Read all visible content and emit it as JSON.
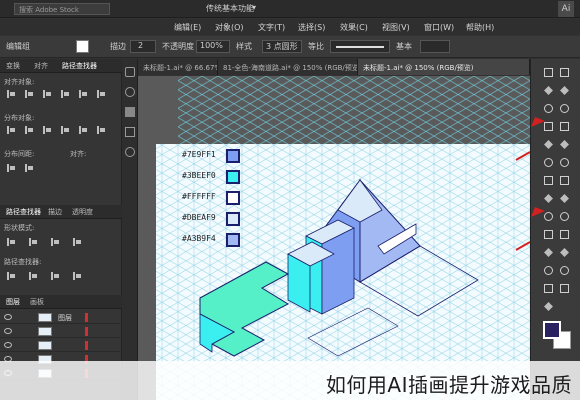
{
  "menubar": {
    "search_placeholder": "搜索 Adobe Stock",
    "workspace": "传统基本功能",
    "app_icon": "Ai"
  },
  "menu": [
    "编辑(E)",
    "对象(O)",
    "文字(T)",
    "选择(S)",
    "效果(C)",
    "视图(V)",
    "窗口(W)",
    "帮助(H)"
  ],
  "control": {
    "object_label": "编辑组",
    "stroke_label": "描边",
    "stroke_value": "2",
    "opacity_label": "不透明度",
    "opacity_value": "100%",
    "style_label": "样式",
    "uniform_label": "等比",
    "brush_label": "3 点圆形",
    "ratio_label": "基本"
  },
  "left_panel": {
    "top_tabs": [
      "变换",
      "对齐",
      "路径查找器"
    ],
    "align_objects": "对齐对象:",
    "distribute_objects": "分布对象:",
    "distribute_spacing": "分布间距:",
    "align_to": "对齐:",
    "pathfinder_tabs": [
      "路径查找器",
      "描边",
      "透明度"
    ],
    "shape_modes": "形状模式:",
    "pathfinders": "路径查找器:",
    "layers_tabs": [
      "图层",
      "画板"
    ],
    "layer_name": "图层",
    "layer_rows": 5
  },
  "doc_tabs": [
    "未标题-1.ai* @ 66.67% (RGB/预览)",
    "81-全色-海南道路.ai* @ 150% (RGB/预览)",
    "未标题-1.ai* @ 150% (RGB/预览)"
  ],
  "legend": [
    {
      "label": "#7E9FF1",
      "color": "#7E9FF1"
    },
    {
      "label": "#3BEEF0",
      "color": "#3BEEF0"
    },
    {
      "label": "#FFFFFF",
      "color": "#FFFFFF"
    },
    {
      "label": "#DBEAF9",
      "color": "#DBEAF9"
    },
    {
      "label": "#A3B9F4",
      "color": "#A3B9F4"
    }
  ],
  "tools": [
    "selection-icon",
    "direct-select-icon",
    "magic-wand-icon",
    "lasso-icon",
    "pen-icon",
    "type-icon",
    "line-icon",
    "rectangle-icon",
    "paintbrush-icon",
    "pencil-icon",
    "eraser-icon",
    "rotate-icon",
    "scale-icon",
    "width-icon",
    "free-transform-icon",
    "shape-builder-icon",
    "perspective-grid-icon",
    "mesh-icon",
    "gradient-icon",
    "eyedropper-icon",
    "blend-icon",
    "symbol-sprayer-icon",
    "column-graph-icon",
    "artboard-icon",
    "slice-icon",
    "hand-icon",
    "zoom-icon"
  ],
  "colors": {
    "accent_fill": "#2a2260",
    "cyan": "#3BEEF0",
    "blue": "#7E9FF1",
    "teal": "#56f0c8",
    "arrow_red": "#d32020"
  },
  "caption": "如何用AI插画提升游戏品质"
}
